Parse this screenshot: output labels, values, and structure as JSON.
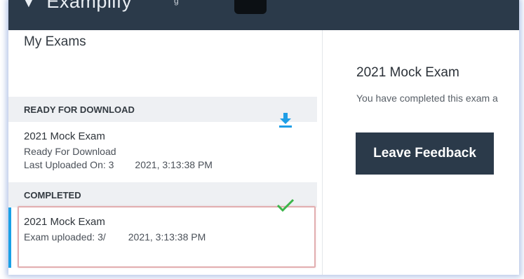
{
  "app": {
    "brand": "Examplify",
    "brand_suffix": "g"
  },
  "sidebar": {
    "title": "My Exams",
    "sections": [
      {
        "header": "READY FOR DOWNLOAD",
        "items": [
          {
            "title": "2021 Mock Exam",
            "status": "Ready For Download",
            "detail_prefix": "Last Uploaded On: 3",
            "detail_suffix": "2021, 3:13:38 PM",
            "icon": "download-icon"
          }
        ]
      },
      {
        "header": "COMPLETED",
        "items": [
          {
            "title": "2021 Mock Exam",
            "detail_prefix": "Exam uploaded: 3/",
            "detail_suffix": "2021, 3:13:38 PM",
            "icon": "check-icon"
          }
        ]
      }
    ]
  },
  "detail": {
    "title": "2021 Mock Exam",
    "text": "You have completed this exam a",
    "button_label": "Leave Feedback"
  },
  "colors": {
    "topbar": "#2b3a4a",
    "accent": "#1aa0e6",
    "success": "#3cb54a",
    "selected_border": "#e2aeb0"
  }
}
